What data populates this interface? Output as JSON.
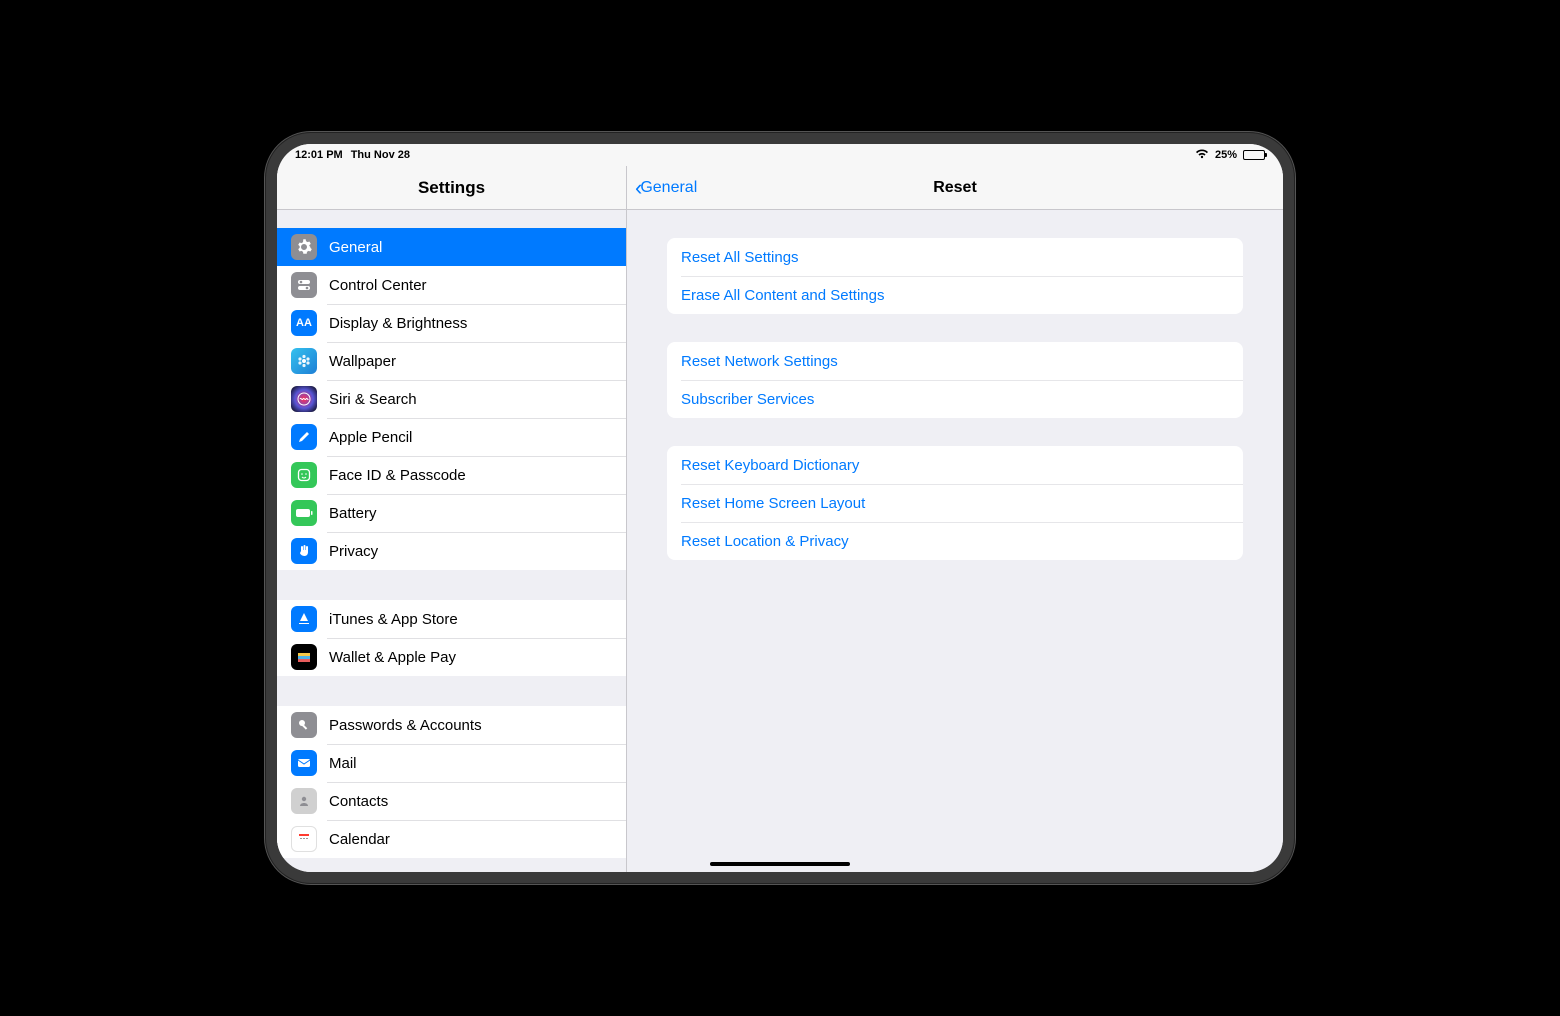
{
  "statusbar": {
    "time": "12:01 PM",
    "date": "Thu Nov 28",
    "battery_percent": "25%"
  },
  "sidebar": {
    "title": "Settings",
    "groups": [
      [
        {
          "id": "general",
          "label": "General",
          "selected": true,
          "icon": "gear",
          "bg": "bg-grey"
        },
        {
          "id": "control-center",
          "label": "Control Center",
          "selected": false,
          "icon": "switches",
          "bg": "bg-grey"
        },
        {
          "id": "display",
          "label": "Display & Brightness",
          "selected": false,
          "icon": "AA",
          "bg": "bg-blue"
        },
        {
          "id": "wallpaper",
          "label": "Wallpaper",
          "selected": false,
          "icon": "flower",
          "bg": "bg-flower"
        },
        {
          "id": "siri",
          "label": "Siri & Search",
          "selected": false,
          "icon": "siri",
          "bg": "bg-siri"
        },
        {
          "id": "pencil",
          "label": "Apple Pencil",
          "selected": false,
          "icon": "pencil",
          "bg": "bg-blue"
        },
        {
          "id": "faceid",
          "label": "Face ID & Passcode",
          "selected": false,
          "icon": "face",
          "bg": "bg-green"
        },
        {
          "id": "battery",
          "label": "Battery",
          "selected": false,
          "icon": "battery",
          "bg": "bg-green"
        },
        {
          "id": "privacy",
          "label": "Privacy",
          "selected": false,
          "icon": "hand",
          "bg": "bg-privacy"
        }
      ],
      [
        {
          "id": "appstore",
          "label": "iTunes & App Store",
          "selected": false,
          "icon": "appstore",
          "bg": "bg-blue"
        },
        {
          "id": "wallet",
          "label": "Wallet & Apple Pay",
          "selected": false,
          "icon": "wallet",
          "bg": "bg-wallet"
        }
      ],
      [
        {
          "id": "passwords",
          "label": "Passwords & Accounts",
          "selected": false,
          "icon": "key",
          "bg": "bg-grey"
        },
        {
          "id": "mail",
          "label": "Mail",
          "selected": false,
          "icon": "mail",
          "bg": "bg-blue"
        },
        {
          "id": "contacts",
          "label": "Contacts",
          "selected": false,
          "icon": "contacts",
          "bg": "bg-contacts"
        },
        {
          "id": "calendar",
          "label": "Calendar",
          "selected": false,
          "icon": "calendar",
          "bg": "bg-cal"
        }
      ]
    ]
  },
  "detail": {
    "back_label": "General",
    "title": "Reset",
    "groups": [
      [
        {
          "id": "reset-all",
          "label": "Reset All Settings"
        },
        {
          "id": "erase-all",
          "label": "Erase All Content and Settings"
        }
      ],
      [
        {
          "id": "reset-network",
          "label": "Reset Network Settings"
        },
        {
          "id": "subscriber",
          "label": "Subscriber Services"
        }
      ],
      [
        {
          "id": "reset-keyboard",
          "label": "Reset Keyboard Dictionary"
        },
        {
          "id": "reset-home",
          "label": "Reset Home Screen Layout"
        },
        {
          "id": "reset-location",
          "label": "Reset Location & Privacy"
        }
      ]
    ]
  }
}
